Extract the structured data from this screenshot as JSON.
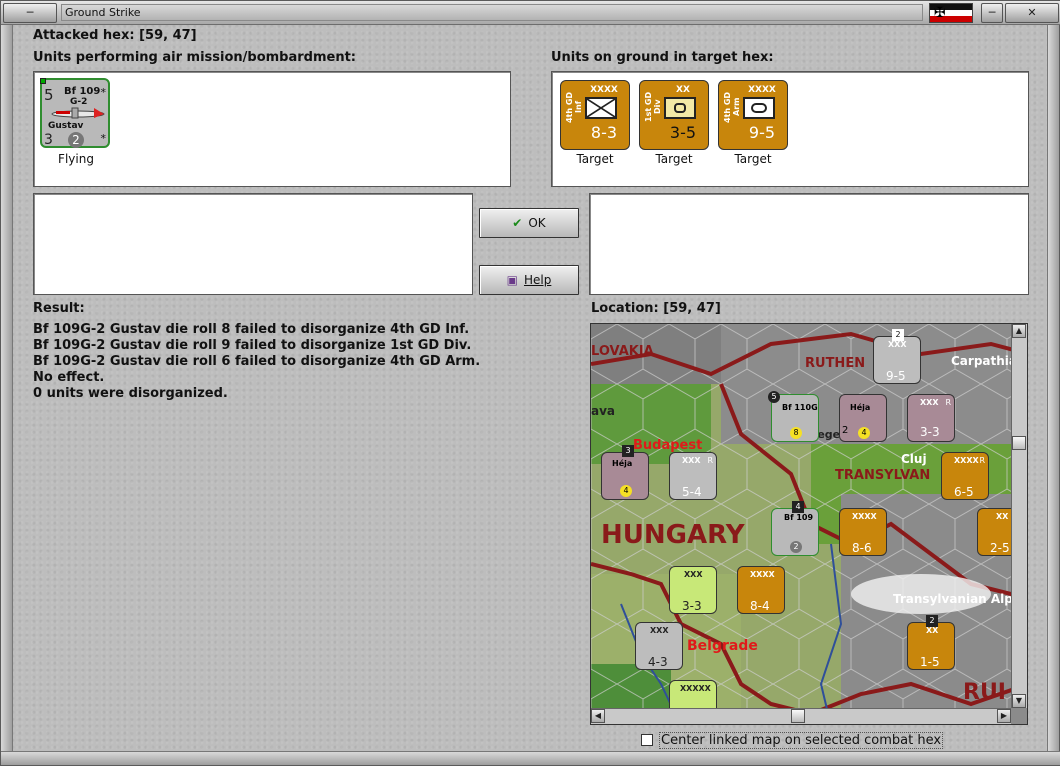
{
  "window": {
    "title": "Ground Strike"
  },
  "attacked_hex": "Attacked hex:  [59, 47]",
  "air_units": {
    "label": "Units performing air mission/bombardment:",
    "units": [
      {
        "name": "Bf 109",
        "variant": "G-2",
        "pilot": "Gustav",
        "top_left": "5",
        "bottom_left": "3",
        "bottom_mid": "2",
        "star_top": "*",
        "star_bottom": "*",
        "status": "Flying"
      }
    ]
  },
  "ground_units": {
    "label": "Units on ground in target hex:",
    "units": [
      {
        "side_label": "4th GD Inf",
        "size": "XXXX",
        "strength": "8-3",
        "status": "Target"
      },
      {
        "side_label": "1st GD Div",
        "size": "XX",
        "strength": "3-5",
        "status": "Target"
      },
      {
        "side_label": "4th GD Arm",
        "size": "XXXX",
        "strength": "9-5",
        "status": "Target"
      }
    ]
  },
  "buttons": {
    "ok": "OK",
    "help": "Help"
  },
  "result": {
    "label": "Result:",
    "lines": [
      "Bf 109G-2 Gustav die roll 8 failed to disorganize 4th GD Inf.",
      "Bf 109G-2 Gustav die roll 9 failed to disorganize 1st GD Div.",
      "Bf 109G-2 Gustav die roll 6 failed to disorganize 4th GD Arm.",
      "No effect.",
      "0 units were disorganized."
    ]
  },
  "location": {
    "label": "Location:  [59, 47]"
  },
  "map": {
    "place_labels": [
      "LOVAKIA",
      "RUTHEN",
      "Carpathia",
      "ava",
      "Budapest",
      "Cluj",
      "TRANSYLVAN",
      "HUNGARY",
      "Transylvanian Alp",
      "Belgrade",
      "RUI",
      "Szeged"
    ],
    "counters": [
      {
        "text": "Bf 110G",
        "strength": "8",
        "badge": "5"
      },
      {
        "text": "Héja",
        "strength": "4",
        "badge": "2"
      },
      {
        "text": "XXX",
        "strength": "3-3",
        "badge": "R"
      },
      {
        "text": "XXX",
        "strength": "9-5",
        "badge": "2"
      },
      {
        "text": "Héja",
        "strength": "4",
        "badge": "3"
      },
      {
        "text": "XXX",
        "strength": "5-4",
        "badge": "R"
      },
      {
        "text": "XXXX",
        "strength": "6-5",
        "badge": "R"
      },
      {
        "text": "Bf 109",
        "strength": "2",
        "badge": "4"
      },
      {
        "text": "XXXX",
        "strength": "8-6",
        "badge": ""
      },
      {
        "text": "XX",
        "strength": "2-5",
        "badge": ""
      },
      {
        "text": "XXX",
        "strength": "3-3",
        "badge": ""
      },
      {
        "text": "XXXX",
        "strength": "8-4",
        "badge": ""
      },
      {
        "text": "XXX",
        "strength": "4-3",
        "badge": ""
      },
      {
        "text": "XX",
        "strength": "1-5",
        "badge": "2"
      },
      {
        "text": "XXXXX",
        "strength": "",
        "badge": ""
      }
    ]
  },
  "checkbox": {
    "label": "Center linked map on selected combat hex",
    "checked": false
  },
  "colors": {
    "gd_counter": "#c8860c",
    "air_border": "#2f8d2f",
    "map_border_red": "#8a1a1a"
  }
}
